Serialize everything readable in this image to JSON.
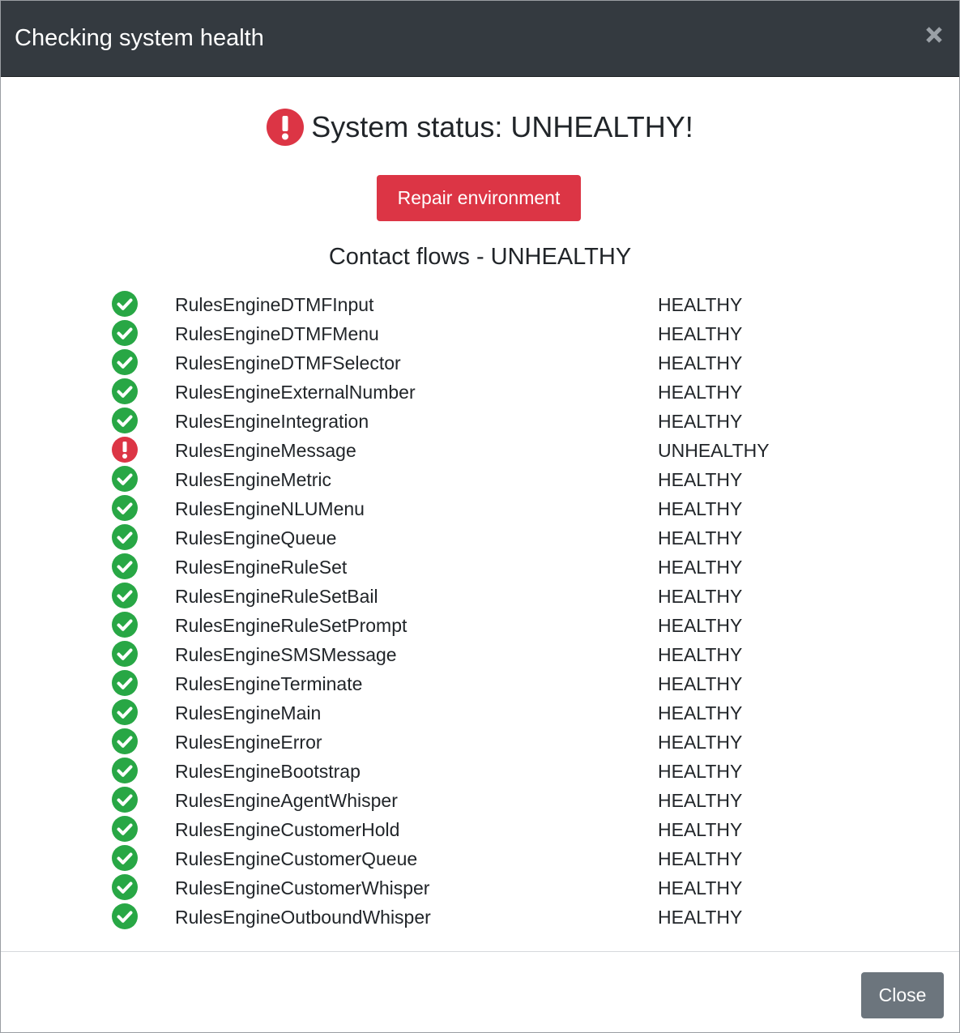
{
  "header": {
    "title": "Checking system health",
    "close_icon": "close-icon"
  },
  "status": {
    "icon": "exclamation-circle-icon",
    "text": "System status: UNHEALTHY!"
  },
  "repair_button": {
    "label": "Repair environment"
  },
  "section": {
    "title": "Contact flows - UNHEALTHY"
  },
  "flows": [
    {
      "name": "RulesEngineDTMFInput",
      "status": "HEALTHY",
      "icon": "check-circle-icon"
    },
    {
      "name": "RulesEngineDTMFMenu",
      "status": "HEALTHY",
      "icon": "check-circle-icon"
    },
    {
      "name": "RulesEngineDTMFSelector",
      "status": "HEALTHY",
      "icon": "check-circle-icon"
    },
    {
      "name": "RulesEngineExternalNumber",
      "status": "HEALTHY",
      "icon": "check-circle-icon"
    },
    {
      "name": "RulesEngineIntegration",
      "status": "HEALTHY",
      "icon": "check-circle-icon"
    },
    {
      "name": "RulesEngineMessage",
      "status": "UNHEALTHY",
      "icon": "exclamation-circle-icon"
    },
    {
      "name": "RulesEngineMetric",
      "status": "HEALTHY",
      "icon": "check-circle-icon"
    },
    {
      "name": "RulesEngineNLUMenu",
      "status": "HEALTHY",
      "icon": "check-circle-icon"
    },
    {
      "name": "RulesEngineQueue",
      "status": "HEALTHY",
      "icon": "check-circle-icon"
    },
    {
      "name": "RulesEngineRuleSet",
      "status": "HEALTHY",
      "icon": "check-circle-icon"
    },
    {
      "name": "RulesEngineRuleSetBail",
      "status": "HEALTHY",
      "icon": "check-circle-icon"
    },
    {
      "name": "RulesEngineRuleSetPrompt",
      "status": "HEALTHY",
      "icon": "check-circle-icon"
    },
    {
      "name": "RulesEngineSMSMessage",
      "status": "HEALTHY",
      "icon": "check-circle-icon"
    },
    {
      "name": "RulesEngineTerminate",
      "status": "HEALTHY",
      "icon": "check-circle-icon"
    },
    {
      "name": "RulesEngineMain",
      "status": "HEALTHY",
      "icon": "check-circle-icon"
    },
    {
      "name": "RulesEngineError",
      "status": "HEALTHY",
      "icon": "check-circle-icon"
    },
    {
      "name": "RulesEngineBootstrap",
      "status": "HEALTHY",
      "icon": "check-circle-icon"
    },
    {
      "name": "RulesEngineAgentWhisper",
      "status": "HEALTHY",
      "icon": "check-circle-icon"
    },
    {
      "name": "RulesEngineCustomerHold",
      "status": "HEALTHY",
      "icon": "check-circle-icon"
    },
    {
      "name": "RulesEngineCustomerQueue",
      "status": "HEALTHY",
      "icon": "check-circle-icon"
    },
    {
      "name": "RulesEngineCustomerWhisper",
      "status": "HEALTHY",
      "icon": "check-circle-icon"
    },
    {
      "name": "RulesEngineOutboundWhisper",
      "status": "HEALTHY",
      "icon": "check-circle-icon"
    }
  ],
  "footer": {
    "close_label": "Close"
  },
  "colors": {
    "header_bg": "#343a40",
    "danger": "#dc3545",
    "success": "#28a745",
    "secondary": "#6c757d"
  }
}
